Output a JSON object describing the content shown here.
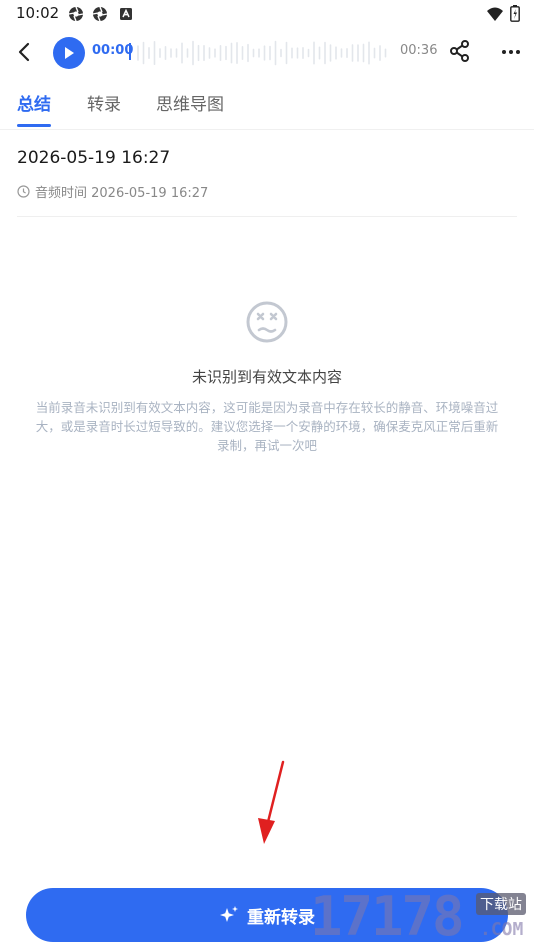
{
  "status_bar": {
    "time": "10:02",
    "left_icons": [
      "aperture-icon",
      "aperture-icon",
      "android-icon"
    ],
    "right_icons": [
      "wifi-icon",
      "battery-icon"
    ]
  },
  "player": {
    "current_time": "00:00",
    "total_time": "00:36",
    "progress": 0
  },
  "tabs": [
    {
      "label": "总结",
      "active": true
    },
    {
      "label": "转录",
      "active": false
    },
    {
      "label": "思维导图",
      "active": false
    }
  ],
  "record": {
    "title": "2026-05-19 16:27",
    "meta": "音频时间 2026-05-19 16:27"
  },
  "empty_state": {
    "title": "未识别到有效文本内容",
    "description": "当前录音未识别到有效文本内容，这可能是因为录音中存在较长的静音、环境噪音过大，或是录音时长过短导致的。建议您选择一个安静的环境，确保麦克风正常后重新录制，再试一次吧"
  },
  "action": {
    "redo_label": "重新转录"
  },
  "watermark": {
    "number": "17178",
    "tag": "下载站",
    "suffix": ".COM"
  },
  "colors": {
    "accent": "#2f6bf1",
    "annotation_arrow": "#e02020"
  }
}
